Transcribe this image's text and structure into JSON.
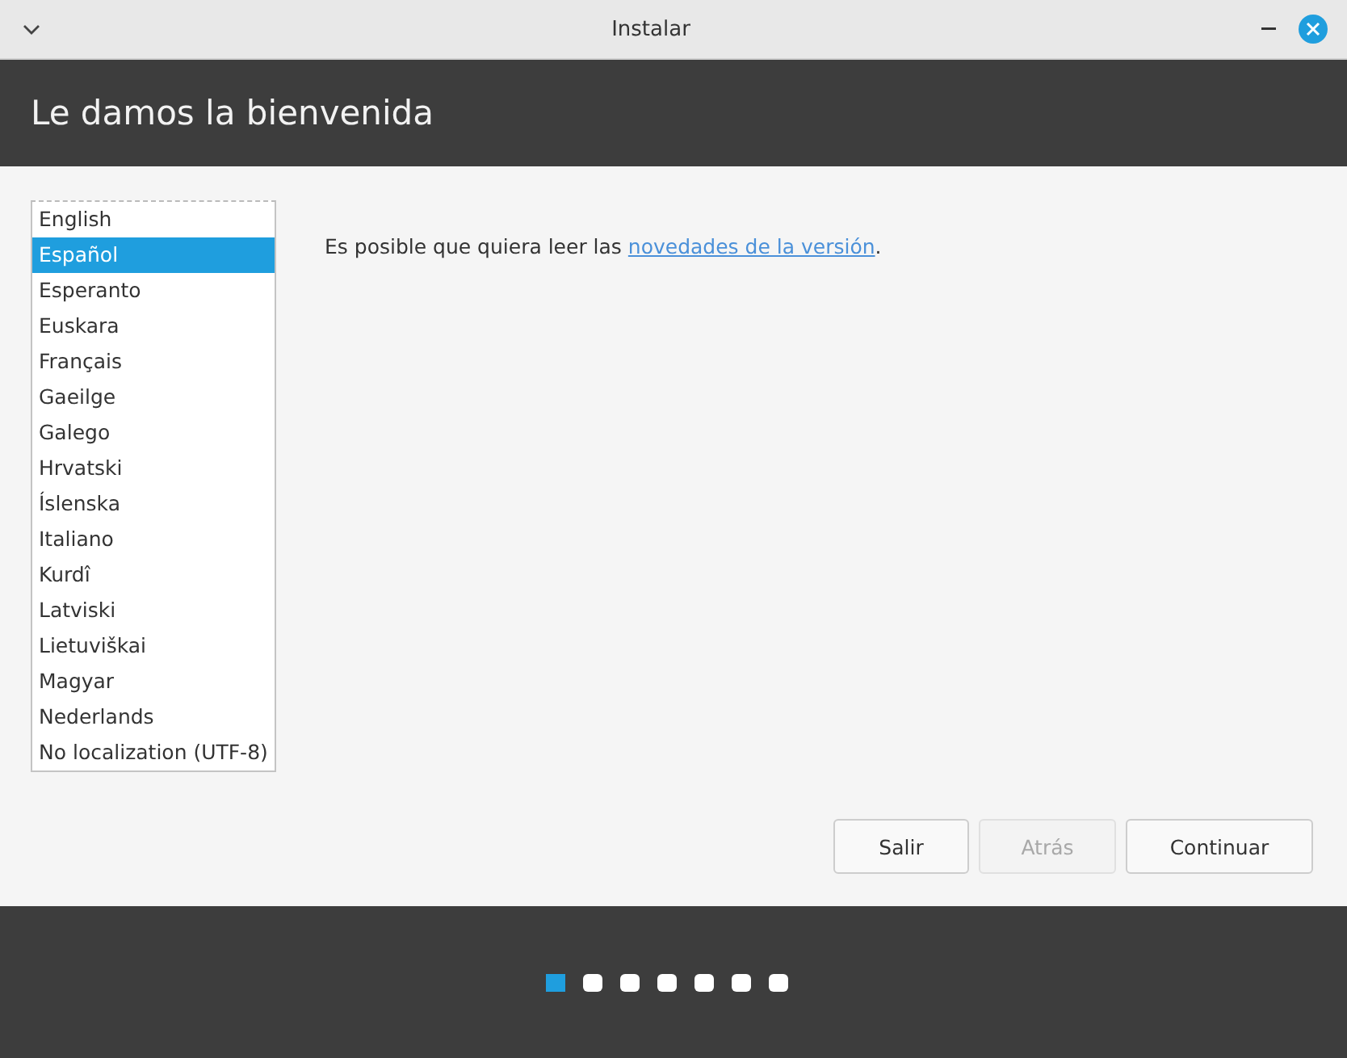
{
  "window": {
    "title": "Instalar"
  },
  "header": {
    "title": "Le damos la bienvenida"
  },
  "languages": [
    {
      "label": "English",
      "selected": false
    },
    {
      "label": "Español",
      "selected": true
    },
    {
      "label": "Esperanto",
      "selected": false
    },
    {
      "label": "Euskara",
      "selected": false
    },
    {
      "label": "Français",
      "selected": false
    },
    {
      "label": "Gaeilge",
      "selected": false
    },
    {
      "label": "Galego",
      "selected": false
    },
    {
      "label": "Hrvatski",
      "selected": false
    },
    {
      "label": "Íslenska",
      "selected": false
    },
    {
      "label": "Italiano",
      "selected": false
    },
    {
      "label": "Kurdî",
      "selected": false
    },
    {
      "label": "Latviski",
      "selected": false
    },
    {
      "label": "Lietuviškai",
      "selected": false
    },
    {
      "label": "Magyar",
      "selected": false
    },
    {
      "label": "Nederlands",
      "selected": false
    },
    {
      "label": "No localization (UTF-8)",
      "selected": false
    }
  ],
  "release_notes": {
    "text": "Es posible que quiera leer las",
    "link": "novedades de la versión",
    "after": "."
  },
  "buttons": [
    {
      "label": "Salir",
      "disabled": false
    },
    {
      "label": "Atrás",
      "disabled": true
    },
    {
      "label": "Continuar",
      "disabled": false
    }
  ],
  "steps": [
    {
      "selected": true
    },
    {
      "selected": false
    },
    {
      "selected": false
    },
    {
      "selected": false
    },
    {
      "selected": false
    },
    {
      "selected": false
    },
    {
      "selected": false
    }
  ]
}
